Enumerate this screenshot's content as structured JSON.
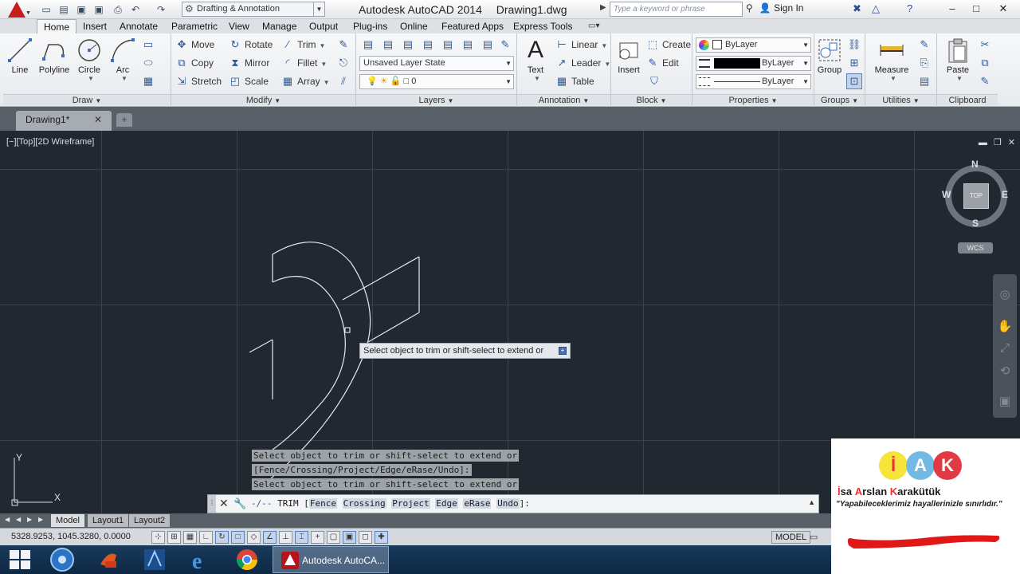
{
  "titlebar": {
    "workspace": "Drafting & Annotation",
    "app_name": "Autodesk AutoCAD 2014",
    "file_name": "Drawing1.dwg",
    "search_placeholder": "Type a keyword or phrase",
    "sign_in": "Sign In"
  },
  "ribbon_tabs": [
    "Home",
    "Insert",
    "Annotate",
    "Parametric",
    "View",
    "Manage",
    "Output",
    "Plug-ins",
    "Online",
    "Featured Apps",
    "Express Tools"
  ],
  "ribbon": {
    "draw": {
      "title": "Draw",
      "line": "Line",
      "polyline": "Polyline",
      "circle": "Circle",
      "arc": "Arc"
    },
    "modify": {
      "title": "Modify",
      "move": "Move",
      "rotate": "Rotate",
      "trim": "Trim",
      "copy": "Copy",
      "mirror": "Mirror",
      "fillet": "Fillet",
      "stretch": "Stretch",
      "scale": "Scale",
      "array": "Array"
    },
    "layers": {
      "title": "Layers",
      "layer_state": "Unsaved Layer State",
      "current_layer": "0"
    },
    "annotation": {
      "title": "Annotation",
      "text": "Text",
      "linear": "Linear",
      "leader": "Leader",
      "table": "Table"
    },
    "block": {
      "title": "Block",
      "insert": "Insert",
      "create": "Create",
      "edit": "Edit"
    },
    "properties": {
      "title": "Properties",
      "color": "ByLayer",
      "lineweight": "ByLayer",
      "linetype": "ByLayer"
    },
    "groups": {
      "title": "Groups",
      "group": "Group"
    },
    "utilities": {
      "title": "Utilities",
      "measure": "Measure"
    },
    "clipboard": {
      "title": "Clipboard",
      "paste": "Paste"
    }
  },
  "document_tab": "Drawing1*",
  "viewport": {
    "label": "[−][Top][2D Wireframe]",
    "viewcube": {
      "n": "N",
      "s": "S",
      "e": "E",
      "w": "W",
      "face": "TOP",
      "wcs": "WCS"
    },
    "tooltip": "Select object to trim or shift-select to extend or"
  },
  "command": {
    "history": [
      "Select object to trim or shift-select to extend or",
      "[Fence/Crossing/Project/Edge/eRase/Undo]:",
      "Select object to trim or shift-select to extend or"
    ],
    "prompt_cmd": "TRIM",
    "options": [
      "Fence",
      "Crossing",
      "Project",
      "Edge",
      "eRase",
      "Undo"
    ],
    "prompt_end": "]:"
  },
  "layout_tabs": [
    "Model",
    "Layout1",
    "Layout2"
  ],
  "status": {
    "coordinates": "5328.9253, 1045.3280, 0.0000",
    "mode": "MODEL"
  },
  "taskbar": {
    "active_app": "Autodesk AutoCA..."
  },
  "watermark": {
    "letters": [
      "İ",
      "A",
      "K"
    ],
    "name_parts": [
      "İ",
      "sa ",
      "A",
      "rslan ",
      "K",
      "arakütük"
    ],
    "slogan": "\"Yapabileceklerimiz hayallerinizle sınırlıdır.\""
  }
}
